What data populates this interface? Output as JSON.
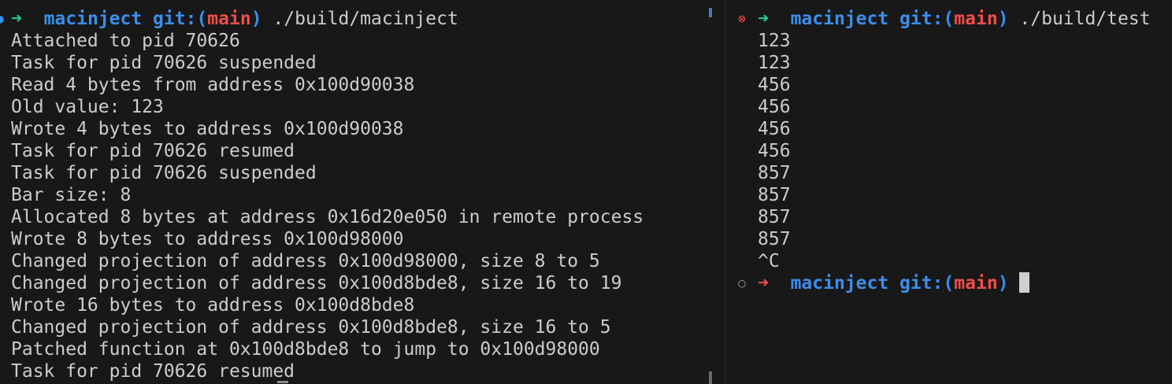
{
  "left": {
    "prompt": {
      "arrow": "➜",
      "dir": "macinject",
      "git_label": "git:(",
      "branch": "main",
      "git_close": ")",
      "command": "./build/macinject"
    },
    "lines": [
      "Attached to pid 70626",
      "Task for pid 70626 suspended",
      "Read 4 bytes from address 0x100d90038",
      "Old value: 123",
      "Wrote 4 bytes to address 0x100d90038",
      "Task for pid 70626 resumed",
      "Task for pid 70626 suspended",
      "Bar size: 8",
      "Allocated 8 bytes at address 0x16d20e050 in remote process",
      "Wrote 8 bytes to address 0x100d98000",
      "Changed projection of address 0x100d98000, size 8 to 5",
      "Changed projection of address 0x100d8bde8, size 16 to 19",
      "Wrote 16 bytes to address 0x100d8bde8",
      "Changed projection of address 0x100d8bde8, size 16 to 5",
      "Patched function at 0x100d8bde8 to jump to 0x100d98000",
      "Task for pid 70626 resumed"
    ]
  },
  "right": {
    "prompt": {
      "status_icon": "⊗",
      "arrow": "➜",
      "dir": "macinject",
      "git_label": "git:(",
      "branch": "main",
      "git_close": ")",
      "command": "./build/test"
    },
    "lines": [
      "123",
      "123",
      "456",
      "456",
      "456",
      "456",
      "857",
      "857",
      "857",
      "857",
      "^C"
    ],
    "idle_prompt": {
      "status_icon": "○",
      "arrow": "➜",
      "dir": "macinject",
      "git_label": "git:(",
      "branch": "main",
      "git_close": ")"
    }
  },
  "colors": {
    "background": "#181818",
    "text": "#cccccc",
    "arrow_success": "#23d18b",
    "arrow_error": "#f14c4c",
    "dir": "#3b8eea",
    "branch": "#f14c4c"
  }
}
